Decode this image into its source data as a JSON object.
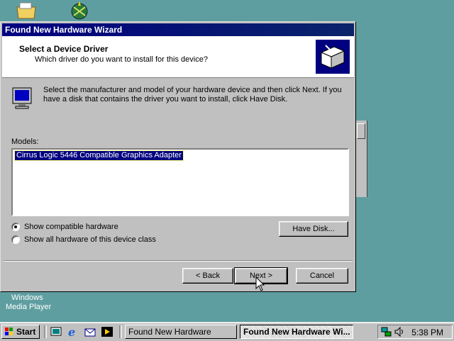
{
  "desktop": {
    "icons": [
      {
        "name": "folder-icon",
        "label": ""
      },
      {
        "name": "network-icon",
        "label": ""
      }
    ],
    "media_player_label_line1": "Windows",
    "media_player_label_line2": "Media Player"
  },
  "wizard": {
    "title": "Found New Hardware Wizard",
    "header_title": "Select a Device Driver",
    "header_subtitle": "Which driver do you want to install for this device?",
    "instructions": "Select the manufacturer and model of your hardware device and then click Next. If you have a disk that contains the driver you want to install, click Have Disk.",
    "models_label": "Models:",
    "models": [
      "Cirrus Logic 5446 Compatible Graphics Adapter"
    ],
    "radio_compatible": "Show compatible hardware",
    "radio_all": "Show all hardware of this device class",
    "have_disk_label": "Have Disk...",
    "back_label": "< Back",
    "next_label": "Next >",
    "cancel_label": "Cancel"
  },
  "taskbar": {
    "start_label": "Start",
    "task1": "Found New Hardware",
    "task2": "Found New Hardware Wi...",
    "clock": "5:38 PM"
  },
  "colors": {
    "desktop": "#5f9ea0",
    "titlebar": "#000080",
    "selection": "#000080"
  }
}
